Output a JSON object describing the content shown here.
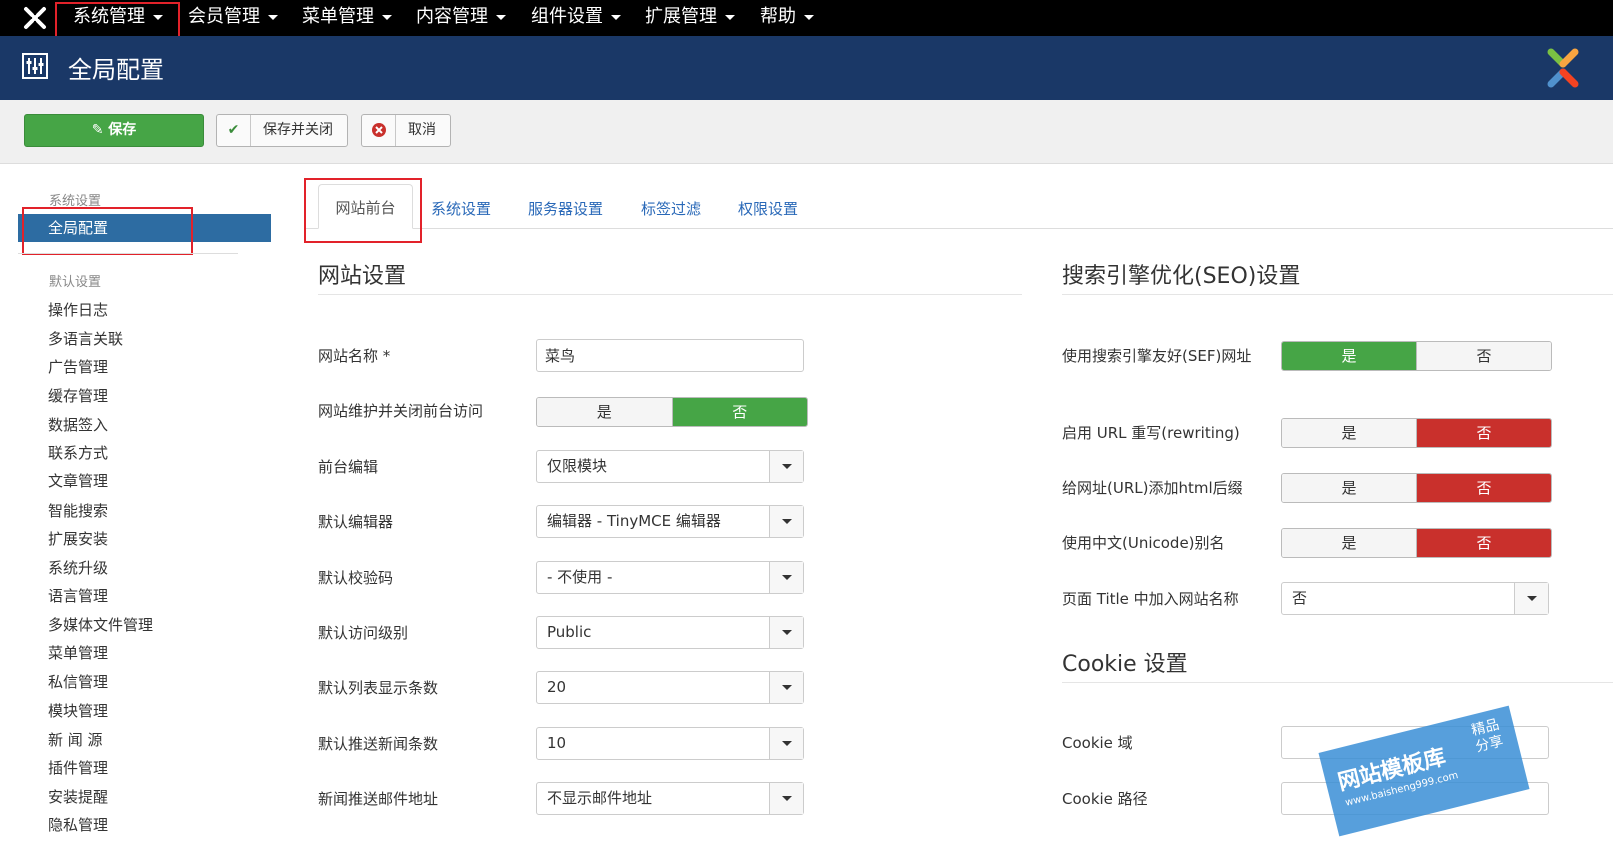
{
  "topnav": {
    "items": [
      "系统管理",
      "会员管理",
      "菜单管理",
      "内容管理",
      "组件设置",
      "扩展管理",
      "帮助"
    ]
  },
  "header": {
    "title": "全局配置"
  },
  "toolbar": {
    "save": "保存",
    "save_close": "保存并关闭",
    "cancel": "取消"
  },
  "sidebar": {
    "heading_system": "系统设置",
    "active_item": "全局配置",
    "heading_default": "默认设置",
    "items": [
      "操作日志",
      "多语言关联",
      "广告管理",
      "缓存管理",
      "数据签入",
      "联系方式",
      "文章管理",
      "智能搜索",
      "扩展安装",
      "系统升级",
      "语言管理",
      "多媒体文件管理",
      "菜单管理",
      "私信管理",
      "模块管理",
      "新 闻 源",
      "插件管理",
      "安装提醒",
      "隐私管理"
    ]
  },
  "tabs": {
    "active": "网站前台",
    "items": [
      "系统设置",
      "服务器设置",
      "标签过滤",
      "权限设置"
    ]
  },
  "site_settings": {
    "title": "网站设置",
    "site_name_label": "网站名称 *",
    "site_name_value": "菜鸟",
    "offline_label": "网站维护并关闭前台访问",
    "yes": "是",
    "no": "否",
    "frontend_edit_label": "前台编辑",
    "frontend_edit_value": "仅限模块",
    "default_editor_label": "默认编辑器",
    "default_editor_value": "编辑器 - TinyMCE 编辑器",
    "captcha_label": "默认校验码",
    "captcha_value": "- 不使用 -",
    "access_label": "默认访问级别",
    "access_value": "Public",
    "list_limit_label": "默认列表显示条数",
    "list_limit_value": "20",
    "feed_limit_label": "默认推送新闻条数",
    "feed_limit_value": "10",
    "feed_email_label": "新闻推送邮件地址",
    "feed_email_value": "不显示邮件地址"
  },
  "seo_settings": {
    "title": "搜索引擎优化(SEO)设置",
    "sef_label": "使用搜索引擎友好(SEF)网址",
    "rewrite_label": "启用 URL 重写(rewriting)",
    "suffix_label": "给网址(URL)添加html后缀",
    "unicode_label": "使用中文(Unicode)别名",
    "sitename_title_label": "页面 Title 中加入网站名称",
    "sitename_title_value": "否",
    "yes": "是",
    "no": "否"
  },
  "cookie_settings": {
    "title": "Cookie 设置",
    "domain_label": "Cookie 域",
    "path_label": "Cookie 路径"
  },
  "watermark": {
    "main": "网站模板库",
    "url": "www.baisheng999.com",
    "badge_1": "精品",
    "badge_2": "分享"
  },
  "colors": {
    "topbar": "#000000",
    "header": "#1a3867",
    "toggle_green": "#46a546",
    "toggle_red": "#c9302c",
    "sidebar_active": "#2d6ca2",
    "highlight": "#e2222a"
  }
}
